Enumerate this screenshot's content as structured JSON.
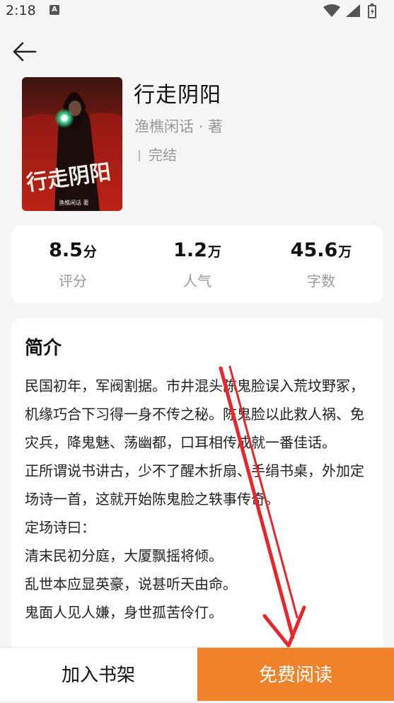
{
  "status_bar": {
    "time": "2:18",
    "notification_badge": "A"
  },
  "book": {
    "title": "行走阴阳",
    "author": "渔樵闲话 · 著",
    "status": "完结",
    "cover": {
      "title_art": "行走阴阳",
      "author_art": "渔樵闲话 著",
      "colors": {
        "top": "#3a1410",
        "mid": "#8e1a12",
        "bottom": "#c8281a"
      }
    }
  },
  "stats": [
    {
      "value": "8.5",
      "unit": "分",
      "label": "评分"
    },
    {
      "value": "1.2",
      "unit": "万",
      "label": "人气"
    },
    {
      "value": "45.6",
      "unit": "万",
      "label": "字数"
    }
  ],
  "intro": {
    "title": "简介",
    "lines": [
      "民国初年，军阀割据。市井混头陈鬼脸误入荒坟野冢，机缘巧合下习得一身不传之秘。陈鬼脸以此救人祸、免灾兵，降鬼魅、荡幽都，口耳相传成就一番佳话。",
      "正所谓说书讲古，少不了醒木折扇、手绢书桌，外加定场诗一首，这就开始陈鬼脸之轶事传奇。",
      "定场诗曰：",
      "清末民初分庭，大厦飘摇将倾。",
      "乱世本应显英豪，说甚听天由命。",
      "鬼面人见人嫌，身世孤苦伶仃。"
    ]
  },
  "actions": {
    "add_to_shelf": "加入书架",
    "free_read": "免费阅读"
  },
  "colors": {
    "accent": "#f0832a",
    "annotation_arrow": "#e8262a"
  }
}
